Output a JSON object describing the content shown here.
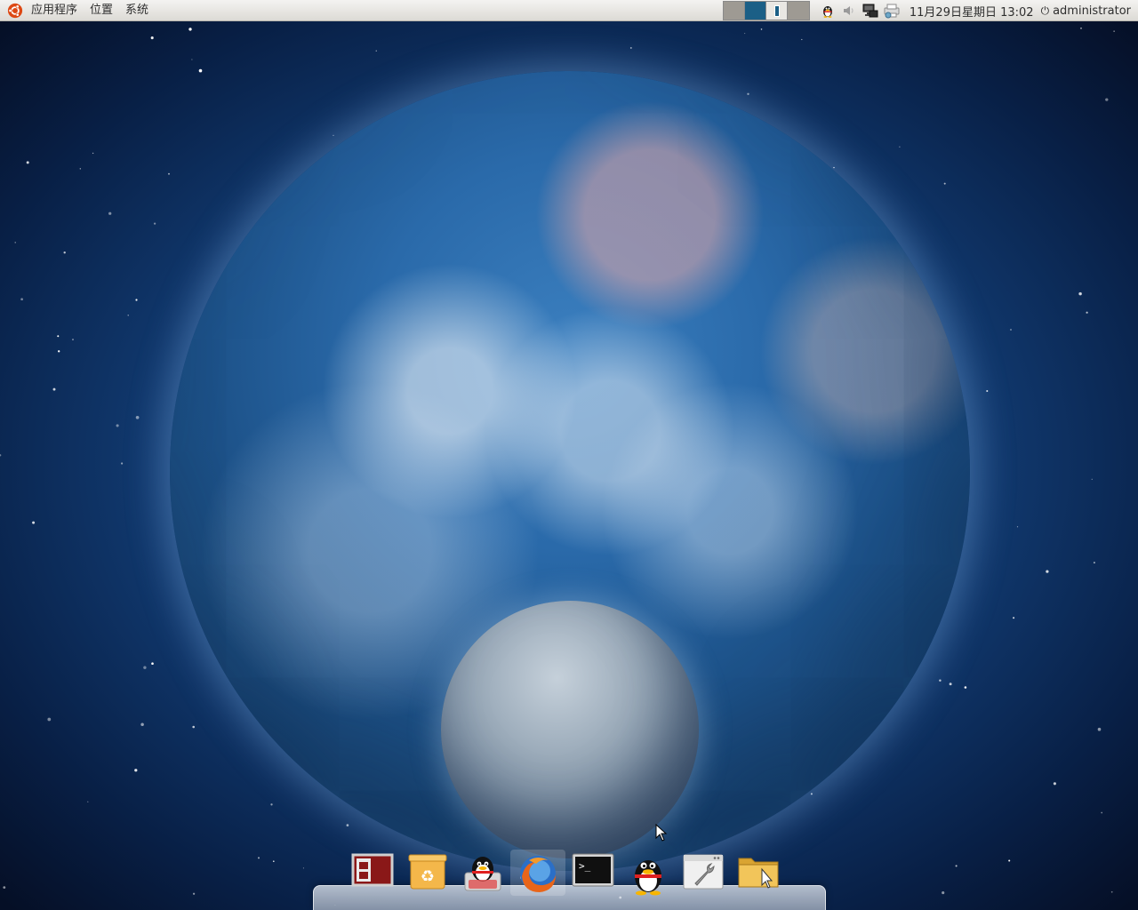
{
  "top_panel": {
    "menus": [
      {
        "label": "应用程序"
      },
      {
        "label": "位置"
      },
      {
        "label": "系统"
      }
    ],
    "clock": "11月29日星期日 13:02",
    "user": "administrator",
    "workspaces": [
      {
        "name": "workspace-1",
        "active": false
      },
      {
        "name": "workspace-2",
        "active": true
      },
      {
        "name": "workspace-3",
        "active": false
      },
      {
        "name": "workspace-4",
        "active": false
      }
    ],
    "tray_icons": [
      "qq-penguin-icon",
      "volume-icon",
      "network-icon",
      "printer-icon"
    ]
  },
  "dock": {
    "items": [
      {
        "name": "dock-item-box-app",
        "icon": "box-app-icon",
        "active": false
      },
      {
        "name": "dock-item-trash",
        "icon": "trash-icon",
        "active": false
      },
      {
        "name": "dock-item-qq-chat",
        "icon": "qq-penguin-icon",
        "active": false
      },
      {
        "name": "dock-item-firefox",
        "icon": "firefox-icon",
        "active": true
      },
      {
        "name": "dock-item-terminal",
        "icon": "terminal-icon",
        "active": false
      },
      {
        "name": "dock-item-qq",
        "icon": "qq-penguin-icon",
        "active": false
      },
      {
        "name": "dock-item-settings",
        "icon": "settings-wrench-icon",
        "active": false
      },
      {
        "name": "dock-item-home-folder",
        "icon": "folder-icon",
        "active": false
      }
    ]
  },
  "colors": {
    "panel_bg": "#dcdad5",
    "workspace_active": "#1b5f86",
    "sky_dark": "#081f45"
  }
}
